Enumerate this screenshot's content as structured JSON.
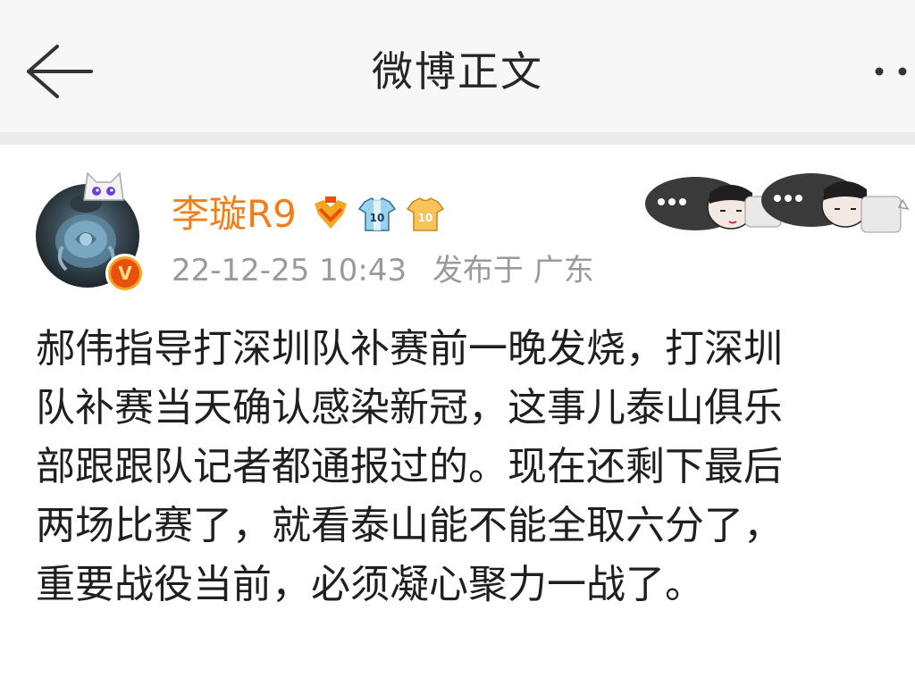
{
  "header": {
    "title": "微博正文"
  },
  "post": {
    "author": "李璇R9",
    "verified_mark": "V",
    "timestamp": "22-12-25 10:43",
    "location": "发布于 广东",
    "badges": [
      {
        "icon": "gold-badge-icon"
      },
      {
        "icon": "jersey-10-blue-icon",
        "number": "10"
      },
      {
        "icon": "jersey-10-gold-icon",
        "number": "10"
      }
    ],
    "body_lines": [
      "郝伟指导打深圳队补赛前一晚发烧，打深圳",
      "队补赛当天确认感染新冠，这事儿泰山俱乐",
      "部跟跟队记者都通报过的。现在还剩下最后",
      "两场比赛了，就看泰山能不能全取六分了，",
      "重要战役当前，必须凝心聚力一战了。"
    ]
  },
  "colors": {
    "username": "#f27e1a",
    "meta": "#9a9a9a",
    "header_bg": "#f7f7f7",
    "divider": "#eaeaea"
  }
}
